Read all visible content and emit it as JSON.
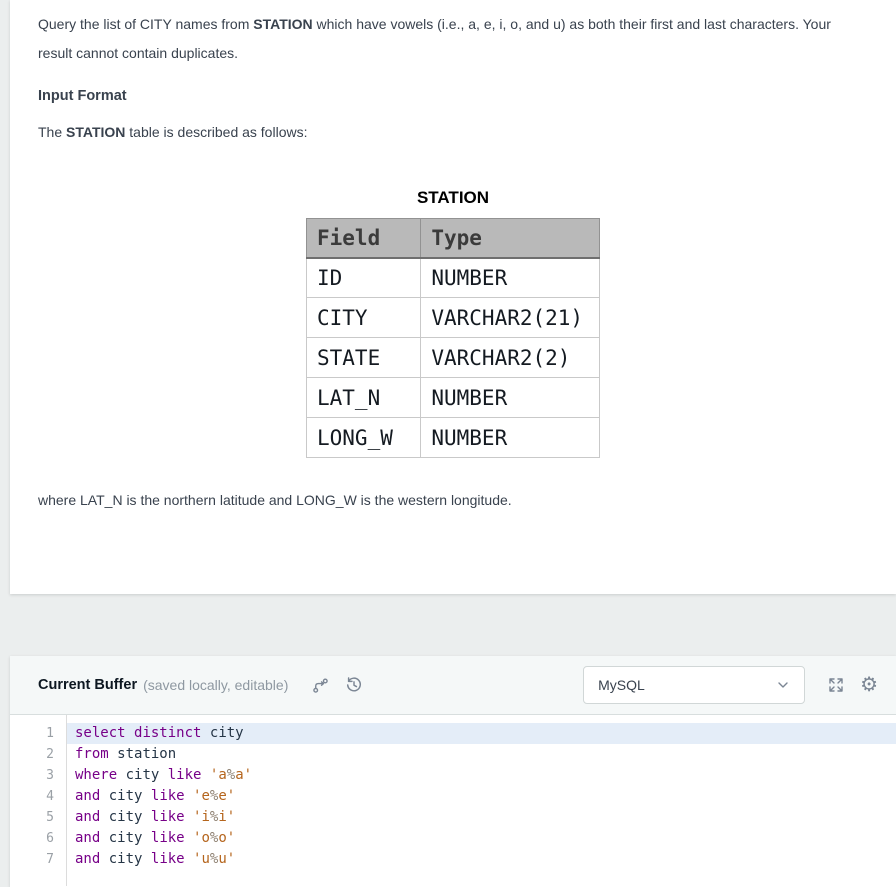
{
  "problem": {
    "statement": {
      "pre": "Query the list of CITY names from ",
      "bold": "STATION",
      "post": " which have vowels (i.e., a, e, i, o, and u) as both their first and last characters. Your result cannot contain duplicates."
    },
    "input_format_heading": "Input Format",
    "table_intro": {
      "pre": "The ",
      "bold": "STATION",
      "post": " table is described as follows:"
    },
    "footnote": "where LAT_N is the northern latitude and LONG_W is the western longitude."
  },
  "schema_table": {
    "title": "STATION",
    "headers": [
      "Field",
      "Type"
    ],
    "rows": [
      [
        "ID",
        "NUMBER"
      ],
      [
        "CITY",
        "VARCHAR2(21)"
      ],
      [
        "STATE",
        "VARCHAR2(2)"
      ],
      [
        "LAT_N",
        "NUMBER"
      ],
      [
        "LONG_W",
        "NUMBER"
      ]
    ]
  },
  "editor_panel": {
    "title": "Current Buffer",
    "subtitle": "(saved locally, editable)",
    "language_select": {
      "value": "MySQL"
    },
    "icons": {
      "fork": "git-fork",
      "history": "history-restore",
      "fullscreen": "fullscreen-expand",
      "settings_glyph": "⚙",
      "chevron": "chevron-down"
    }
  },
  "code": {
    "lines": [
      {
        "n": "1",
        "active": true,
        "tokens": [
          [
            "k",
            "select"
          ],
          [
            "t",
            " "
          ],
          [
            "k",
            "distinct"
          ],
          [
            "t",
            " "
          ],
          [
            "v",
            "city"
          ]
        ]
      },
      {
        "n": "2",
        "active": false,
        "tokens": [
          [
            "k",
            "from"
          ],
          [
            "t",
            " "
          ],
          [
            "v",
            "station"
          ]
        ]
      },
      {
        "n": "3",
        "active": false,
        "tokens": [
          [
            "k",
            "where"
          ],
          [
            "t",
            " "
          ],
          [
            "v",
            "city"
          ],
          [
            "t",
            " "
          ],
          [
            "k",
            "like"
          ],
          [
            "t",
            " "
          ],
          [
            "s",
            "'a"
          ],
          [
            "p",
            "%"
          ],
          [
            "s",
            "a'"
          ]
        ]
      },
      {
        "n": "4",
        "active": false,
        "tokens": [
          [
            "k",
            "and"
          ],
          [
            "t",
            " "
          ],
          [
            "v",
            "city"
          ],
          [
            "t",
            " "
          ],
          [
            "k",
            "like"
          ],
          [
            "t",
            " "
          ],
          [
            "s",
            "'e"
          ],
          [
            "p",
            "%"
          ],
          [
            "s",
            "e'"
          ]
        ]
      },
      {
        "n": "5",
        "active": false,
        "tokens": [
          [
            "k",
            "and"
          ],
          [
            "t",
            " "
          ],
          [
            "v",
            "city"
          ],
          [
            "t",
            " "
          ],
          [
            "k",
            "like"
          ],
          [
            "t",
            " "
          ],
          [
            "s",
            "'i"
          ],
          [
            "p",
            "%"
          ],
          [
            "s",
            "i'"
          ]
        ]
      },
      {
        "n": "6",
        "active": false,
        "tokens": [
          [
            "k",
            "and"
          ],
          [
            "t",
            " "
          ],
          [
            "v",
            "city"
          ],
          [
            "t",
            " "
          ],
          [
            "k",
            "like"
          ],
          [
            "t",
            " "
          ],
          [
            "s",
            "'o"
          ],
          [
            "p",
            "%"
          ],
          [
            "s",
            "o'"
          ]
        ]
      },
      {
        "n": "7",
        "active": false,
        "tokens": [
          [
            "k",
            "and"
          ],
          [
            "t",
            " "
          ],
          [
            "v",
            "city"
          ],
          [
            "t",
            " "
          ],
          [
            "k",
            "like"
          ],
          [
            "t",
            " "
          ],
          [
            "s",
            "'u"
          ],
          [
            "p",
            "%"
          ],
          [
            "s",
            "u'"
          ]
        ]
      }
    ]
  },
  "colors": {
    "kw": "#770088",
    "variable": "#253546",
    "string": "#b5651d",
    "pct": "#8f8273",
    "activeline": "#e4edf8",
    "icon": "#7b8694",
    "text": "#39424e"
  }
}
